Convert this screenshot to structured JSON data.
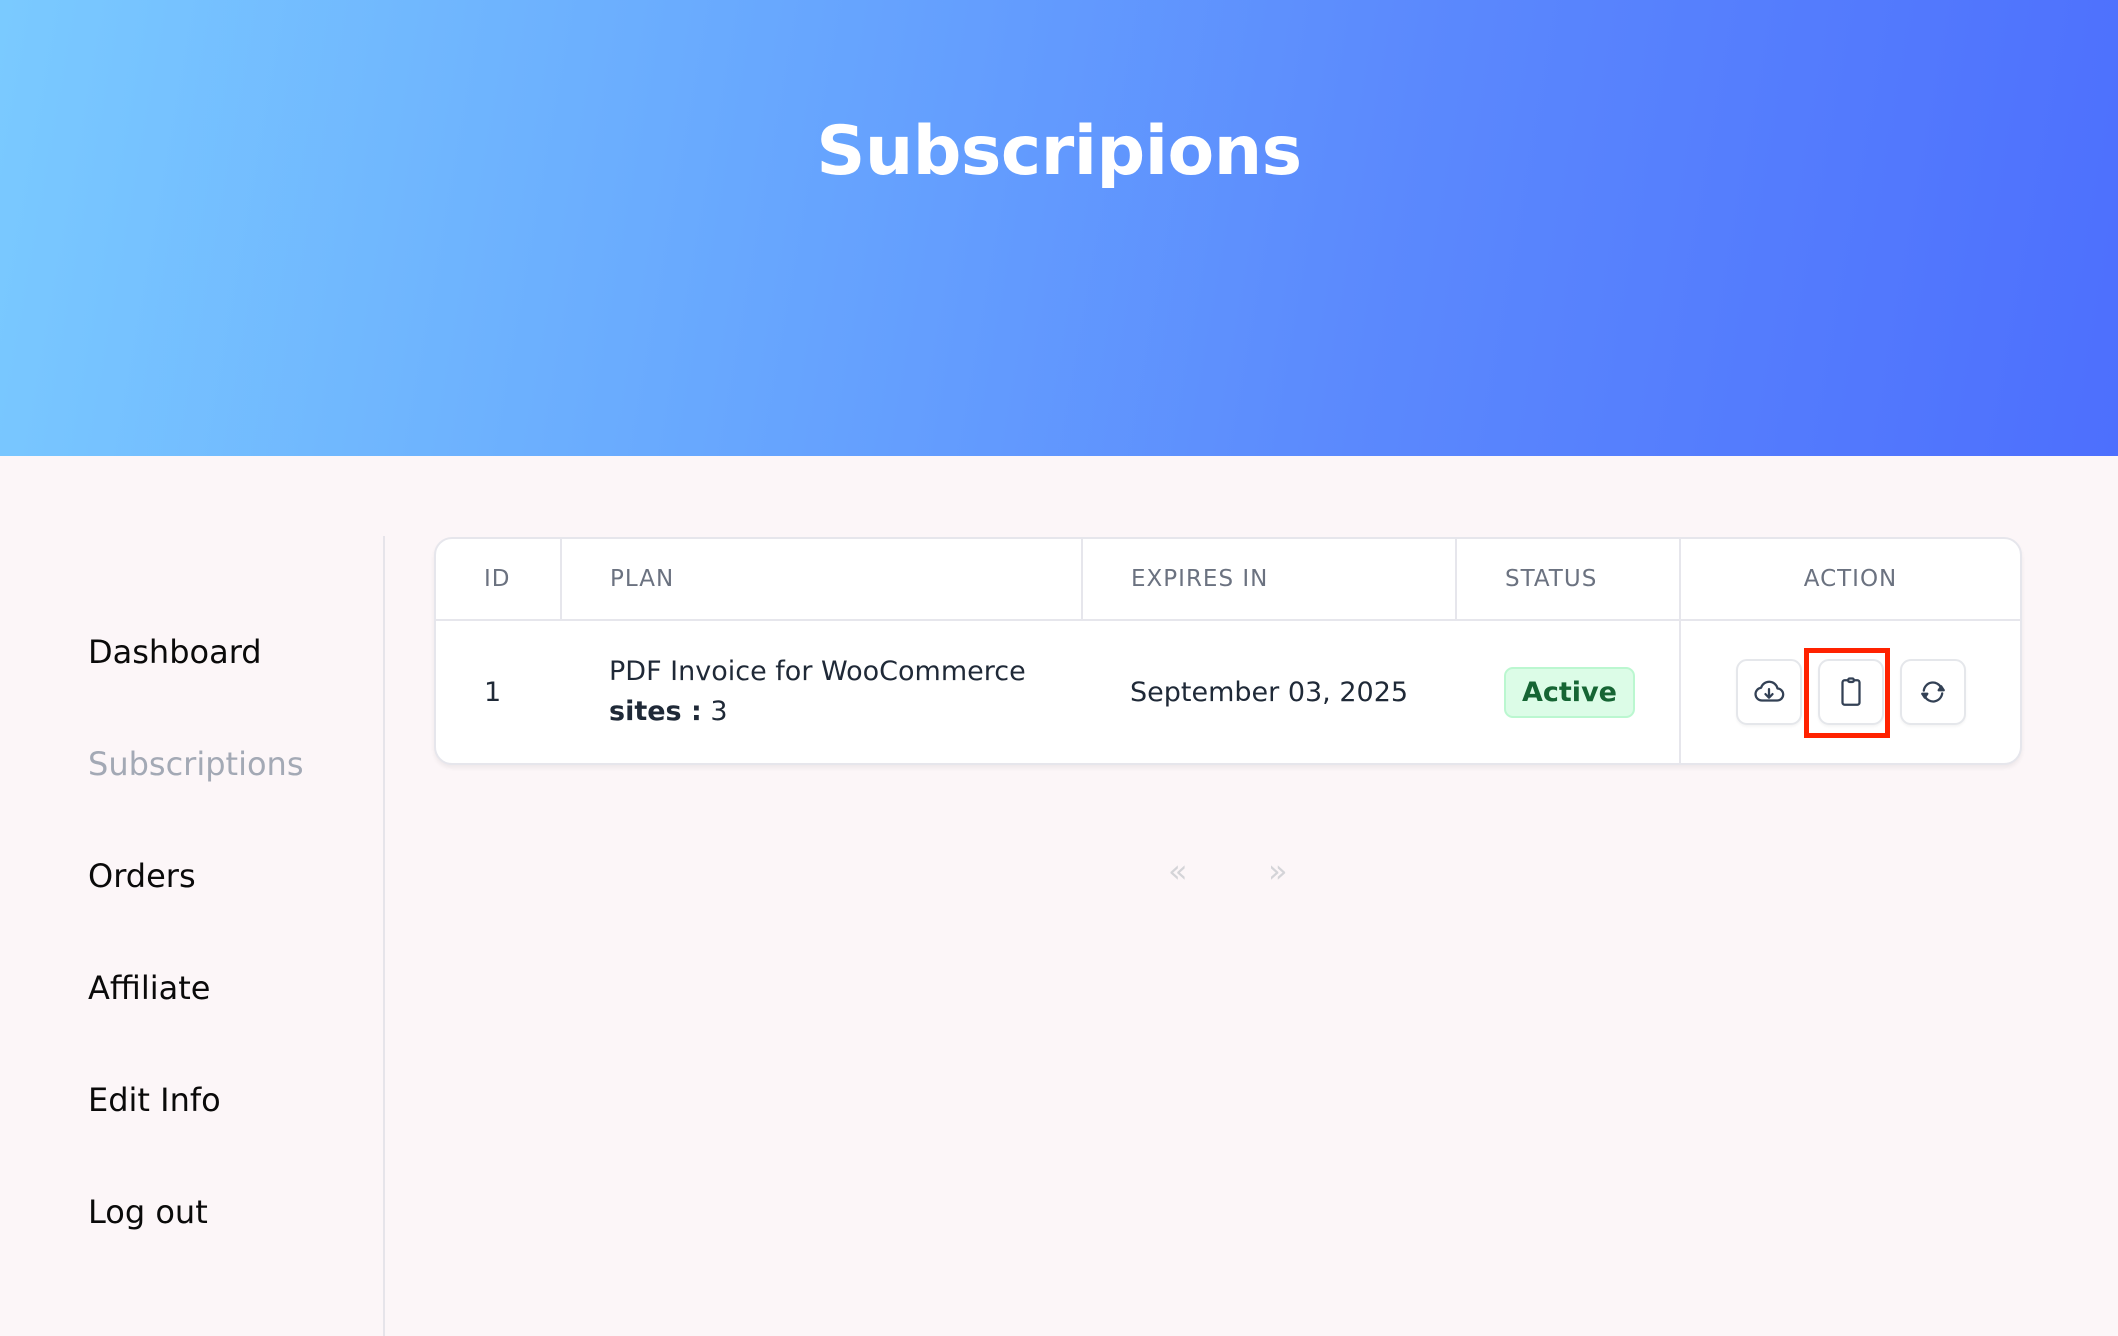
{
  "header": {
    "title": "Subscripions"
  },
  "sidebar": {
    "items": [
      {
        "label": "Dashboard",
        "active": false
      },
      {
        "label": "Subscriptions",
        "active": true
      },
      {
        "label": "Orders",
        "active": false
      },
      {
        "label": "Affiliate",
        "active": false
      },
      {
        "label": "Edit Info",
        "active": false
      },
      {
        "label": "Log out",
        "active": false
      }
    ]
  },
  "table": {
    "columns": [
      "ID",
      "PLAN",
      "EXPIRES IN",
      "STATUS",
      "ACTION"
    ],
    "rows": [
      {
        "id": "1",
        "plan_name": "PDF Invoice for WooCommerce",
        "sites_label": "sites :",
        "sites_value": "3",
        "expires": "September 03, 2025",
        "status": "Active",
        "actions": [
          {
            "icon": "cloud-download-icon"
          },
          {
            "icon": "clipboard-icon",
            "highlighted": true
          },
          {
            "icon": "refresh-icon"
          }
        ]
      }
    ]
  },
  "pagination": {
    "prev": "«",
    "next": "»"
  },
  "colors": {
    "gradient_start": "#7acaff",
    "gradient_end": "#4d6ffd",
    "status_active_bg": "#dcfce7",
    "status_active_text": "#166534",
    "highlight": "#ff2200"
  }
}
